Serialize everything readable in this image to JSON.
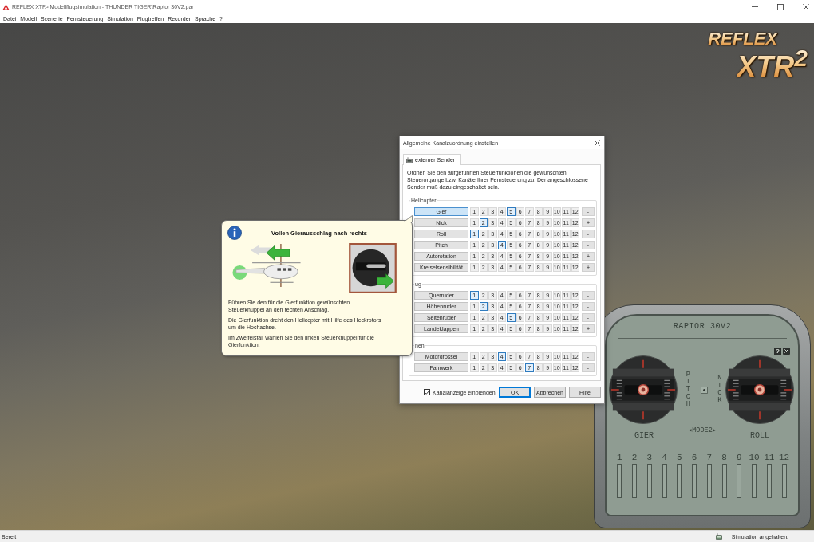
{
  "window": {
    "title": "REFLEX XTR² Modellflugsimulation - THUNDER TIGER\\Raptor 30V2.par"
  },
  "menu": [
    "Datei",
    "Modell",
    "Szenerie",
    "Fernsteuerung",
    "Simulation",
    "Flugtreffen",
    "Recorder",
    "Sprache",
    "?"
  ],
  "logo": {
    "line_1": "REFLEX",
    "line_2": "XTR$^{2}$"
  },
  "dialog": {
    "title": "Allgemeine Kanalzuordnung einstellen",
    "tabs": [
      {
        "label": "externer Sender",
        "selected": true
      }
    ],
    "description": "Ordnen Sie den aufgeführten Steuerfunktionen die gewünschten Steuerorgange bzw. Kanäle Ihrer Fernsteuerung zu. Der angeschlossene Sender muß dazu eingeschaltet sein.",
    "groups": [
      {
        "label": "Helicopter",
        "rows": [
          {
            "function": "Gier",
            "selected": true,
            "reverse": "-",
            "channels": [
              {
                "label": "1",
                "selected": false
              },
              {
                "label": "2",
                "selected": false
              },
              {
                "label": "3",
                "selected": false
              },
              {
                "label": "4",
                "selected": false
              },
              {
                "label": "5",
                "selected": true
              },
              {
                "label": "6",
                "selected": false
              },
              {
                "label": "7",
                "selected": false
              },
              {
                "label": "8",
                "selected": false
              },
              {
                "label": "9",
                "selected": false
              },
              {
                "label": "10",
                "selected": false
              },
              {
                "label": "11",
                "selected": false
              },
              {
                "label": "12",
                "selected": false
              }
            ]
          },
          {
            "function": "Nick",
            "selected": false,
            "reverse": "+",
            "channels": [
              {
                "label": "1",
                "selected": false
              },
              {
                "label": "2",
                "selected": true
              },
              {
                "label": "3",
                "selected": false
              },
              {
                "label": "4",
                "selected": false
              },
              {
                "label": "5",
                "selected": false
              },
              {
                "label": "6",
                "selected": false
              },
              {
                "label": "7",
                "selected": false
              },
              {
                "label": "8",
                "selected": false
              },
              {
                "label": "9",
                "selected": false
              },
              {
                "label": "10",
                "selected": false
              },
              {
                "label": "11",
                "selected": false
              },
              {
                "label": "12",
                "selected": false
              }
            ]
          },
          {
            "function": "Roll",
            "selected": false,
            "reverse": "-",
            "channels": [
              {
                "label": "1",
                "selected": true
              },
              {
                "label": "2",
                "selected": false
              },
              {
                "label": "3",
                "selected": false
              },
              {
                "label": "4",
                "selected": false
              },
              {
                "label": "5",
                "selected": false
              },
              {
                "label": "6",
                "selected": false
              },
              {
                "label": "7",
                "selected": false
              },
              {
                "label": "8",
                "selected": false
              },
              {
                "label": "9",
                "selected": false
              },
              {
                "label": "10",
                "selected": false
              },
              {
                "label": "11",
                "selected": false
              },
              {
                "label": "12",
                "selected": false
              }
            ]
          },
          {
            "function": "Pitch",
            "selected": false,
            "reverse": "-",
            "channels": [
              {
                "label": "1",
                "selected": false
              },
              {
                "label": "2",
                "selected": false
              },
              {
                "label": "3",
                "selected": false
              },
              {
                "label": "4",
                "selected": true
              },
              {
                "label": "5",
                "selected": false
              },
              {
                "label": "6",
                "selected": false
              },
              {
                "label": "7",
                "selected": false
              },
              {
                "label": "8",
                "selected": false
              },
              {
                "label": "9",
                "selected": false
              },
              {
                "label": "10",
                "selected": false
              },
              {
                "label": "11",
                "selected": false
              },
              {
                "label": "12",
                "selected": false
              }
            ]
          },
          {
            "function": "Autorotation",
            "selected": false,
            "reverse": "+",
            "channels": [
              {
                "label": "1",
                "selected": false
              },
              {
                "label": "2",
                "selected": false
              },
              {
                "label": "3",
                "selected": false
              },
              {
                "label": "4",
                "selected": false
              },
              {
                "label": "5",
                "selected": false
              },
              {
                "label": "6",
                "selected": false
              },
              {
                "label": "7",
                "selected": false
              },
              {
                "label": "8",
                "selected": false
              },
              {
                "label": "9",
                "selected": false
              },
              {
                "label": "10",
                "selected": false
              },
              {
                "label": "11",
                "selected": false
              },
              {
                "label": "12",
                "selected": false
              }
            ]
          },
          {
            "function": "Kreiselsensibilität",
            "selected": false,
            "reverse": "+",
            "channels": [
              {
                "label": "1",
                "selected": false
              },
              {
                "label": "2",
                "selected": false
              },
              {
                "label": "3",
                "selected": false
              },
              {
                "label": "4",
                "selected": false
              },
              {
                "label": "5",
                "selected": false
              },
              {
                "label": "6",
                "selected": false
              },
              {
                "label": "7",
                "selected": false
              },
              {
                "label": "8",
                "selected": false
              },
              {
                "label": "9",
                "selected": false
              },
              {
                "label": "10",
                "selected": false
              },
              {
                "label": "11",
                "selected": false
              },
              {
                "label": "12",
                "selected": false
              }
            ]
          }
        ]
      },
      {
        "label": "ug",
        "rows": [
          {
            "function": "Querruder",
            "selected": false,
            "reverse": "-",
            "channels": [
              {
                "label": "1",
                "selected": true
              },
              {
                "label": "2",
                "selected": false
              },
              {
                "label": "3",
                "selected": false
              },
              {
                "label": "4",
                "selected": false
              },
              {
                "label": "5",
                "selected": false
              },
              {
                "label": "6",
                "selected": false
              },
              {
                "label": "7",
                "selected": false
              },
              {
                "label": "8",
                "selected": false
              },
              {
                "label": "9",
                "selected": false
              },
              {
                "label": "10",
                "selected": false
              },
              {
                "label": "11",
                "selected": false
              },
              {
                "label": "12",
                "selected": false
              }
            ]
          },
          {
            "function": "Höhenruder",
            "selected": false,
            "reverse": "-",
            "channels": [
              {
                "label": "1",
                "selected": false
              },
              {
                "label": "2",
                "selected": true
              },
              {
                "label": "3",
                "selected": false
              },
              {
                "label": "4",
                "selected": false
              },
              {
                "label": "5",
                "selected": false
              },
              {
                "label": "6",
                "selected": false
              },
              {
                "label": "7",
                "selected": false
              },
              {
                "label": "8",
                "selected": false
              },
              {
                "label": "9",
                "selected": false
              },
              {
                "label": "10",
                "selected": false
              },
              {
                "label": "11",
                "selected": false
              },
              {
                "label": "12",
                "selected": false
              }
            ]
          },
          {
            "function": "Seitenruder",
            "selected": false,
            "reverse": "-",
            "channels": [
              {
                "label": "1",
                "selected": false
              },
              {
                "label": "2",
                "selected": false
              },
              {
                "label": "3",
                "selected": false
              },
              {
                "label": "4",
                "selected": false
              },
              {
                "label": "5",
                "selected": true
              },
              {
                "label": "6",
                "selected": false
              },
              {
                "label": "7",
                "selected": false
              },
              {
                "label": "8",
                "selected": false
              },
              {
                "label": "9",
                "selected": false
              },
              {
                "label": "10",
                "selected": false
              },
              {
                "label": "11",
                "selected": false
              },
              {
                "label": "12",
                "selected": false
              }
            ]
          },
          {
            "function": "Landeklappen",
            "selected": false,
            "reverse": "+",
            "channels": [
              {
                "label": "1",
                "selected": false
              },
              {
                "label": "2",
                "selected": false
              },
              {
                "label": "3",
                "selected": false
              },
              {
                "label": "4",
                "selected": false
              },
              {
                "label": "5",
                "selected": false
              },
              {
                "label": "6",
                "selected": false
              },
              {
                "label": "7",
                "selected": false
              },
              {
                "label": "8",
                "selected": false
              },
              {
                "label": "9",
                "selected": false
              },
              {
                "label": "10",
                "selected": false
              },
              {
                "label": "11",
                "selected": false
              },
              {
                "label": "12",
                "selected": false
              }
            ]
          }
        ]
      },
      {
        "label": "nen",
        "rows": [
          {
            "function": "Motordrossel",
            "selected": false,
            "reverse": "-",
            "channels": [
              {
                "label": "1",
                "selected": false
              },
              {
                "label": "2",
                "selected": false
              },
              {
                "label": "3",
                "selected": false
              },
              {
                "label": "4",
                "selected": true
              },
              {
                "label": "5",
                "selected": false
              },
              {
                "label": "6",
                "selected": false
              },
              {
                "label": "7",
                "selected": false
              },
              {
                "label": "8",
                "selected": false
              },
              {
                "label": "9",
                "selected": false
              },
              {
                "label": "10",
                "selected": false
              },
              {
                "label": "11",
                "selected": false
              },
              {
                "label": "12",
                "selected": false
              }
            ]
          },
          {
            "function": "Fahrwerk",
            "selected": false,
            "reverse": "-",
            "channels": [
              {
                "label": "1",
                "selected": false
              },
              {
                "label": "2",
                "selected": false
              },
              {
                "label": "3",
                "selected": false
              },
              {
                "label": "4",
                "selected": false
              },
              {
                "label": "5",
                "selected": false
              },
              {
                "label": "6",
                "selected": false
              },
              {
                "label": "7",
                "selected": true
              },
              {
                "label": "8",
                "selected": false
              },
              {
                "label": "9",
                "selected": false
              },
              {
                "label": "10",
                "selected": false
              },
              {
                "label": "11",
                "selected": false
              },
              {
                "label": "12",
                "selected": false
              }
            ]
          }
        ]
      }
    ],
    "checkbox": {
      "label": "Kanalanzeige einblenden",
      "checked": true
    },
    "buttons": [
      {
        "label": "OK",
        "default": true
      },
      {
        "label": "Abbrechen",
        "default": false
      },
      {
        "label": "Hilfe",
        "default": false
      }
    ]
  },
  "balloon": {
    "title": "Vollen Gierausschlag nach rechts",
    "paragraphs": [
      "Führen Sie den für die Gierfunktion gewünschten\nSteuerknüppel an den rechten Anschlag.",
      "Die Gierfunktion dreht den Helicopter mit Hilfe des Heckrotors\num die Hochachse.",
      "Im Zweifelsfall wählen Sie den linken Steuerknüppel für die\nGierfunktion."
    ]
  },
  "transmitter": {
    "model": "RAPTOR 30V2",
    "help_button": "?",
    "sticks": [
      {
        "horizontal": "GIER",
        "vertical": "PITCH"
      },
      {
        "horizontal": "ROLL",
        "vertical": "NICK"
      }
    ],
    "mode": "◂MODE2▸",
    "channels": [
      {
        "label": "1",
        "level": 0.5
      },
      {
        "label": "2",
        "level": 0.5
      },
      {
        "label": "3",
        "level": 0.5
      },
      {
        "label": "4",
        "level": 0.5
      },
      {
        "label": "5",
        "level": 0.5
      },
      {
        "label": "6",
        "level": 0.5
      },
      {
        "label": "7",
        "level": 0.5
      },
      {
        "label": "8",
        "level": 0.5
      },
      {
        "label": "9",
        "level": 0.5
      },
      {
        "label": "10",
        "level": 0.5
      },
      {
        "label": "11",
        "level": 0.5
      },
      {
        "label": "12",
        "level": 0.5
      }
    ]
  },
  "status_bar": {
    "left": "Bereit",
    "right": "Simulation angehalten."
  }
}
